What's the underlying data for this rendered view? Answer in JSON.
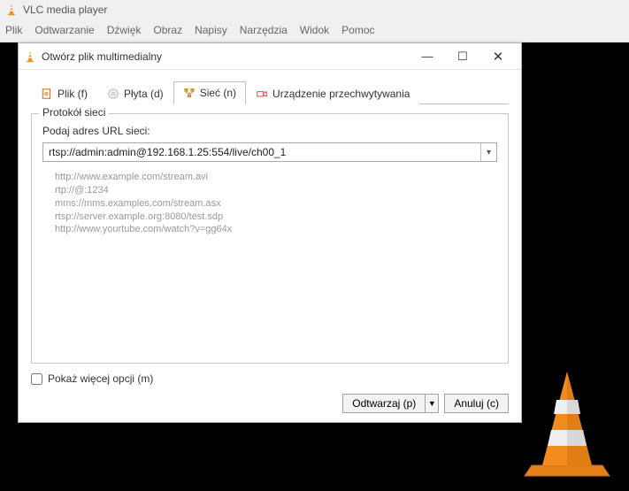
{
  "main": {
    "title": "VLC media player",
    "menu": [
      "Plik",
      "Odtwarzanie",
      "Dźwięk",
      "Obraz",
      "Napisy",
      "Narzędzia",
      "Widok",
      "Pomoc"
    ]
  },
  "dialog": {
    "title": "Otwórz plik multimedialny",
    "tabs": {
      "file": "Plik (f)",
      "disc": "Płyta (d)",
      "network": "Sieć (n)",
      "capture": "Urządzenie przechwytywania"
    },
    "group_legend": "Protokół sieci",
    "url_label": "Podaj adres URL sieci:",
    "url_value": "rtsp://admin:admin@192.168.1.25:554/live/ch00_1",
    "examples": [
      "http://www.example.com/stream.avi",
      "rtp://@:1234",
      "mms://mms.examples.com/stream.asx",
      "rtsp://server.example.org:8080/test.sdp",
      "http://www.yourtube.com/watch?v=gg64x"
    ],
    "more_options": "Pokaż więcej opcji (m)",
    "play": "Odtwarzaj (p)",
    "cancel": "Anuluj (c)"
  }
}
